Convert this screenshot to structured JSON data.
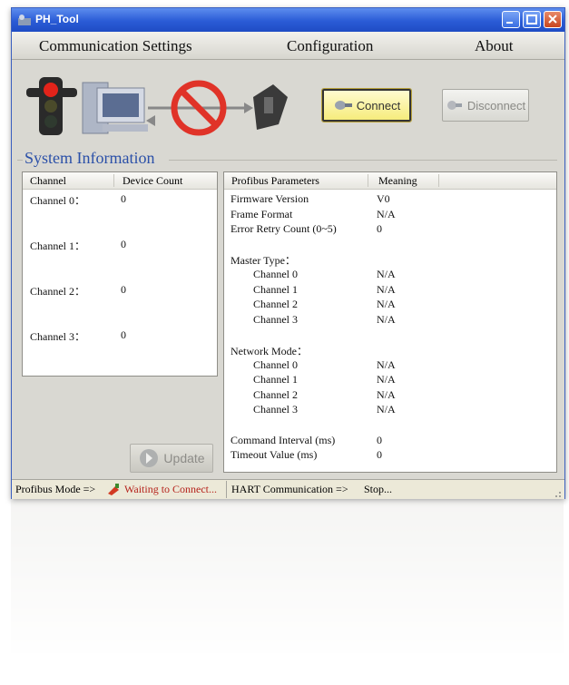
{
  "window": {
    "title": "PH_Tool"
  },
  "menu": {
    "items": [
      "Communication Settings",
      "Configuration",
      "About"
    ]
  },
  "toolbar": {
    "connect_label": "Connect",
    "disconnect_label": "Disconnect"
  },
  "system_info": {
    "title": "System Information"
  },
  "channels": {
    "headers": [
      "Channel",
      "Device Count"
    ],
    "rows": [
      {
        "label": "Channel 0：",
        "count": "0"
      },
      {
        "label": "Channel 1：",
        "count": "0"
      },
      {
        "label": "Channel 2：",
        "count": "0"
      },
      {
        "label": "Channel 3：",
        "count": "0"
      }
    ],
    "update_label": "Update"
  },
  "params": {
    "headers": [
      "Profibus Parameters",
      "Meaning"
    ],
    "rows": [
      {
        "name": "Firmware Version",
        "value": "V0",
        "indent": false
      },
      {
        "name": "Frame Format",
        "value": "N/A",
        "indent": false
      },
      {
        "name": "Error Retry Count (0~5)",
        "value": "0",
        "indent": false
      },
      {
        "name": "",
        "value": "",
        "indent": false
      },
      {
        "name": "Master Type：",
        "value": "",
        "indent": false
      },
      {
        "name": "Channel 0",
        "value": "N/A",
        "indent": true
      },
      {
        "name": "Channel 1",
        "value": "N/A",
        "indent": true
      },
      {
        "name": "Channel 2",
        "value": "N/A",
        "indent": true
      },
      {
        "name": "Channel 3",
        "value": "N/A",
        "indent": true
      },
      {
        "name": "",
        "value": "",
        "indent": false
      },
      {
        "name": "Network Mode：",
        "value": "",
        "indent": false
      },
      {
        "name": "Channel 0",
        "value": "N/A",
        "indent": true
      },
      {
        "name": "Channel 1",
        "value": "N/A",
        "indent": true
      },
      {
        "name": "Channel 2",
        "value": "N/A",
        "indent": true
      },
      {
        "name": "Channel 3",
        "value": "N/A",
        "indent": true
      },
      {
        "name": "",
        "value": "",
        "indent": false
      },
      {
        "name": "Command Interval (ms)",
        "value": "0",
        "indent": false
      },
      {
        "name": "Timeout Value (ms)",
        "value": "0",
        "indent": false
      }
    ]
  },
  "status": {
    "profibus_label": "Profibus Mode =>",
    "profibus_value": "Waiting to Connect...",
    "hart_label": "HART Communication =>",
    "hart_value": "Stop..."
  },
  "colors": {
    "accent": "#2b50a8",
    "status_waiting": "#b5221b",
    "connect_bg": "#f6ec7c",
    "title_bar": "#2a5bd6"
  },
  "icons": [
    "app-icon",
    "minimize-icon",
    "maximize-icon",
    "close-icon",
    "traffic-light-icon",
    "computer-icon",
    "no-connection-icon",
    "device-icon",
    "plug-icon",
    "update-icon",
    "status-plug-icon"
  ]
}
